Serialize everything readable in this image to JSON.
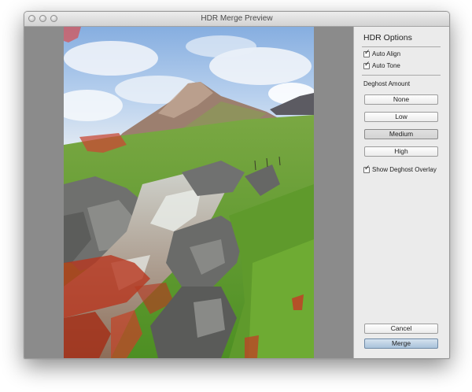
{
  "window": {
    "title": "HDR Merge Preview"
  },
  "panel": {
    "title": "HDR Options",
    "auto_align": {
      "label": "Auto Align",
      "checked": true
    },
    "auto_tone": {
      "label": "Auto Tone",
      "checked": true
    },
    "deghost_label": "Deghost Amount",
    "deghost_options": [
      "None",
      "Low",
      "Medium",
      "High"
    ],
    "deghost_selected": "Medium",
    "show_overlay": {
      "label": "Show Deghost Overlay",
      "checked": true
    },
    "cancel_label": "Cancel",
    "merge_label": "Merge"
  },
  "colors": {
    "overlay": "#d2261f",
    "merge_button": "#b4c8dc",
    "sky": "#9ec0e6",
    "grass": "#5f9a2c"
  }
}
